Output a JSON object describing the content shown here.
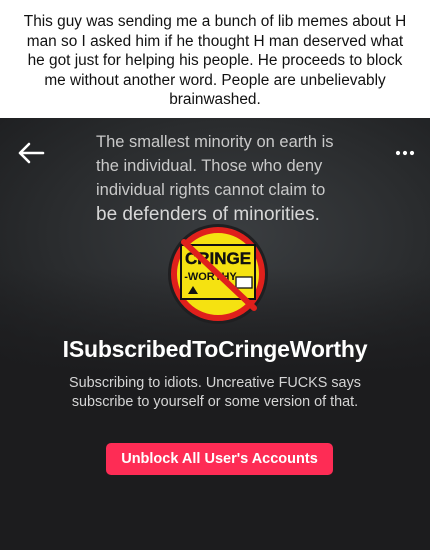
{
  "caption": {
    "text": "This guy was sending me a bunch of lib memes about H man so I asked him if he thought H man deserved what he got just for helping his people. He proceeds to block me without another word. People are unbelievably brainwashed."
  },
  "profile": {
    "banner_quote": {
      "lines": [
        "The smallest minority on earth is",
        "the individual. Those who deny",
        "individual rights cannot claim to",
        "be defenders of minorities."
      ]
    },
    "avatar": {
      "logo_text_top": "CRINGE",
      "logo_text_bottom": "-WORTHY-",
      "icon": "no-cringe-logo-icon"
    },
    "username": "ISubscribedToCringeWorthy",
    "bio": "Subscribing to idiots. Uncreative FUCKS says subscribe to yourself or some version of that.",
    "unblock_button_label": "Unblock All User's Accounts"
  },
  "toolbar": {
    "back_icon": "back-arrow-icon",
    "more_icon": "more-options-icon"
  },
  "colors": {
    "accent": "#fe2c55",
    "screen_bg": "#1c1c1e",
    "logo_yellow": "#f5e211",
    "prohibit_red": "#e0201c"
  }
}
